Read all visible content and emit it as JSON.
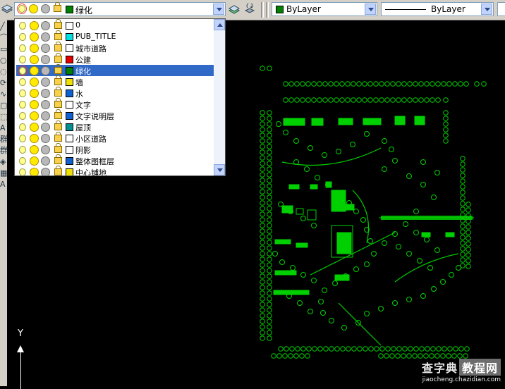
{
  "toolbar": {
    "layer_combo": {
      "current_layer": "绿化",
      "current_color": "#008000"
    },
    "color_combo": {
      "value": "ByLayer",
      "color": "#008000"
    },
    "linetype_combo": {
      "value": "ByLayer"
    }
  },
  "layer_dropdown": {
    "layers": [
      {
        "name": "0",
        "color": "#ffffff"
      },
      {
        "name": "PUB_TITLE",
        "color": "#00e0e0"
      },
      {
        "name": "城市道路",
        "color": "#ffffff"
      },
      {
        "name": "公建",
        "color": "#e00000"
      },
      {
        "name": "绿化",
        "color": "#008000",
        "selected": true
      },
      {
        "name": "墙",
        "color": "#f0e000"
      },
      {
        "name": "水",
        "color": "#1060d0"
      },
      {
        "name": "文字",
        "color": "#ffffff"
      },
      {
        "name": "文字说明层",
        "color": "#1060d0"
      },
      {
        "name": "屋顶",
        "color": "#009090"
      },
      {
        "name": "小区道路",
        "color": "#ffffff"
      },
      {
        "name": "阴影",
        "color": "#ffffff"
      },
      {
        "name": "整体图框层",
        "color": "#1060d0"
      },
      {
        "name": "中心铺地",
        "color": "#f0e000"
      }
    ]
  },
  "left_toolbar": {
    "glyphs": [
      "╱",
      "⌒",
      "▭",
      "○",
      "◌",
      "⟳",
      "∿",
      "▢",
      "⬚",
      "A",
      "群",
      "群",
      "◈",
      "▦",
      "A"
    ]
  },
  "ucs_icon": {
    "y_label": "Y"
  },
  "watermark": {
    "brand": "查字典",
    "box": "教程网",
    "url": "jiaocheng.chazidian.com"
  },
  "colors": {
    "drawing": "#00d000",
    "background": "#000000",
    "toolbar": "#d4d0c8",
    "selection": "#3169c6"
  }
}
